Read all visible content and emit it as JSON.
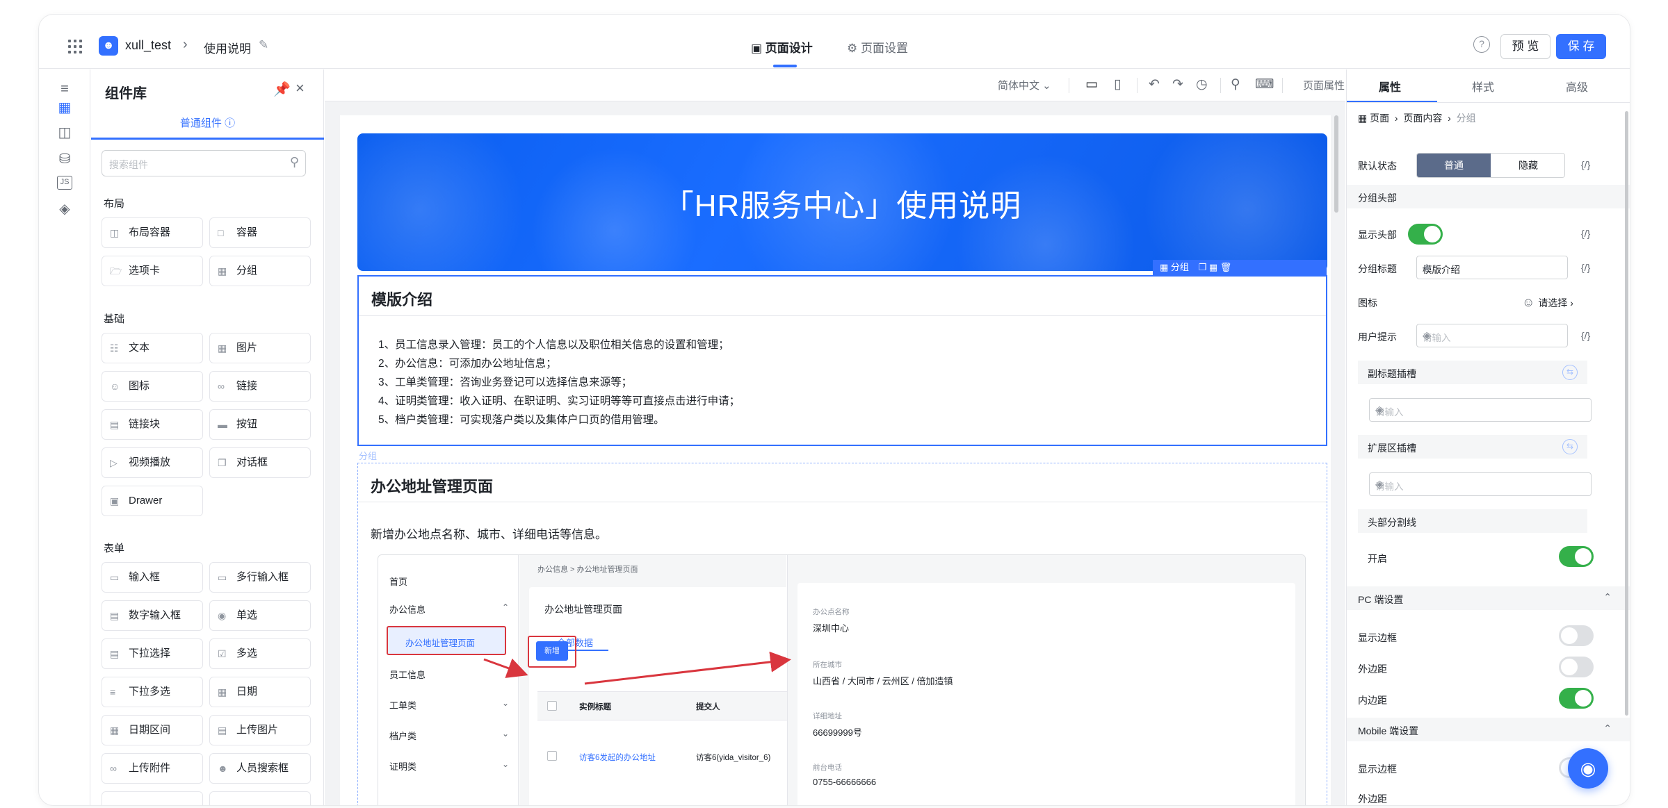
{
  "header": {
    "app_icon": "user-badge-icon",
    "app_name": "xull_test",
    "separator": ">",
    "page_name": "使用说明",
    "tabs": [
      {
        "label": "页面设计",
        "icon": "layout-icon",
        "active": true
      },
      {
        "label": "页面设置",
        "icon": "gear-icon",
        "active": false
      }
    ],
    "help_icon": "?",
    "preview_label": "预 览",
    "save_label": "保 存"
  },
  "rail": {
    "items": [
      "outline-icon",
      "components-icon",
      "templates-icon",
      "database-icon",
      "js-icon",
      "globe-icon"
    ],
    "js_label": "JS"
  },
  "library": {
    "title": "组件库",
    "tab": "普通组件 ⓘ",
    "search_placeholder": "搜索组件",
    "sections": [
      {
        "label": "布局",
        "items": [
          "布局容器",
          "容器",
          "选项卡",
          "分组"
        ]
      },
      {
        "label": "基础",
        "items": [
          "文本",
          "图片",
          "图标",
          "链接",
          "链接块",
          "按钮",
          "视频播放",
          "对话框",
          "Drawer"
        ]
      },
      {
        "label": "表单",
        "items": [
          "输入框",
          "多行输入框",
          "数字输入框",
          "单选",
          "下拉选择",
          "多选",
          "下拉多选",
          "日期",
          "日期区间",
          "上传图片",
          "上传附件",
          "人员搜索框"
        ]
      }
    ]
  },
  "canvas_toolbar": {
    "language": "简体中文",
    "page_props": "页面属性"
  },
  "canvas": {
    "hero_title": "「HR服务中心」使用说明",
    "group_tag": "分组",
    "group_hint": "分组",
    "group1": {
      "title": "模版介绍",
      "lines": [
        "1、员工信息录入管理：员工的个人信息以及职位相关信息的设置和管理；",
        "2、办公信息：可添加办公地址信息；",
        "3、工单类管理：咨询业务登记可以选择信息来源等；",
        "4、证明类管理：收入证明、在职证明、实习证明等等可直接点击进行申请；",
        "5、档户类管理：可实现落户类以及集体户口页的借用管理。"
      ]
    },
    "group2": {
      "title": "办公地址管理页面",
      "desc": "新增办公地点名称、城市、详细电话等信息。",
      "screenshot": {
        "nav": [
          "首页",
          "办公信息",
          "办公地址管理页面",
          "员工信息",
          "工单类",
          "档户类",
          "证明类"
        ],
        "crumb": "办公信息  >  办公地址管理页面",
        "card_title": "办公地址管理页面",
        "tab": "全部数据",
        "new_button": "新增",
        "table_headers": [
          "实例标题",
          "提交人"
        ],
        "table_row": [
          "访客6发起的办公地址",
          "访客6(yida_visitor_6)"
        ],
        "fields": [
          {
            "label": "办公点名称",
            "value": "深圳中心"
          },
          {
            "label": "所在城市",
            "value": "山西省 / 大同市 / 云州区 / 倍加造镇"
          },
          {
            "label": "详细地址",
            "value": "66699999号"
          },
          {
            "label": "前台电话",
            "value": "0755-66666666"
          }
        ]
      }
    }
  },
  "props": {
    "tabs": [
      "属性",
      "样式",
      "高级"
    ],
    "breadcrumb": [
      "页面",
      "页面内容",
      "分组"
    ],
    "default_state_label": "默认状态",
    "default_state_options": [
      "普通",
      "隐藏"
    ],
    "code_tag": "{/}",
    "section_header": "分组头部",
    "show_header_label": "显示头部",
    "show_header": true,
    "group_title_label": "分组标题",
    "group_title_value": "模版介绍",
    "icon_label": "图标",
    "icon_choose": "请选择",
    "user_tip_label": "用户提示",
    "input_placeholder": "请输入",
    "subtitle_slot": "副标题插槽",
    "extend_slot": "扩展区插槽",
    "header_divider": "头部分割线",
    "enable_label": "开启",
    "enable": true,
    "pc_section": "PC 端设置",
    "pc_show_border": "显示边框",
    "pc_show_border_on": false,
    "pc_margin": "外边距",
    "pc_margin_on": false,
    "pc_padding": "内边距",
    "pc_padding_on": true,
    "mobile_section": "Mobile 端设置",
    "mobile_show_border": "显示边框",
    "mobile_margin": "外边距"
  },
  "colors": {
    "accent": "#3370ff",
    "hero": "#0b5ff0",
    "toggle_on": "#34b04a",
    "annotation": "#d9363e"
  }
}
